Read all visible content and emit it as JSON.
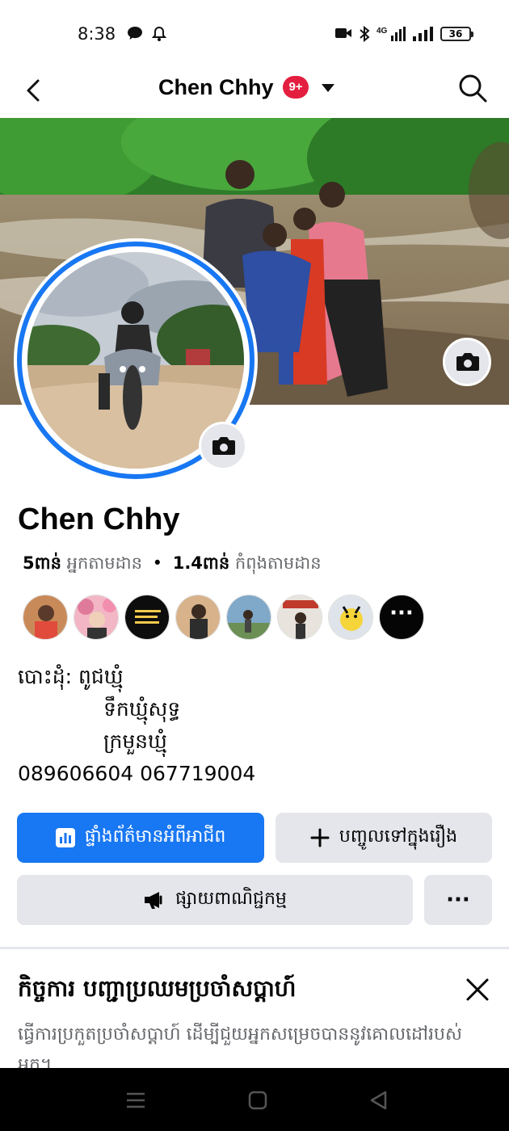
{
  "status_bar": {
    "time": "8:38",
    "battery": "36",
    "network": "4G"
  },
  "header": {
    "title": "Chen Chhy",
    "badge": "9+"
  },
  "profile": {
    "name": "Chen Chhy",
    "followers_count": "5ពាន់",
    "followers_label": "អ្នកតាមដាន",
    "separator": "•",
    "following_count": "1.4ពាន់",
    "following_label": "កំពុងតាមដាន"
  },
  "friends": {
    "more": "···"
  },
  "bio": {
    "line1": "បោះដុំ: ពូជឃ្មុំ",
    "line2": "ទឹកឃ្មុំសុទ្ធ",
    "line3": "ក្រមួនឃ្មុំ",
    "line4": "089606604  067719004"
  },
  "buttons": {
    "dashboard": "ផ្ទាំងព័ត៌មានអំពីអាជីព",
    "add_story": "បញ្ចូលទៅក្នុងរឿង",
    "advertise": "ផ្សាយពាណិជ្ជកម្ម",
    "more": "···"
  },
  "task_card": {
    "title": "កិច្ចការ បញ្ជាប្រឈមប្រចាំសប្តាហ៍",
    "description": "ធ្វើការប្រកួតប្រចាំសប្តាហ៍ ដើម្បីជួយអ្នកសម្រេចបាននូវគោលដៅរបស់អ្នក។"
  },
  "colors": {
    "accent": "#1877f2",
    "badge": "#e41e3f",
    "button_gray": "#e4e6eb"
  },
  "icons": [
    "back-arrow-icon",
    "search-icon",
    "camera-icon",
    "chart-icon",
    "plus-icon",
    "megaphone-icon",
    "close-icon"
  ]
}
